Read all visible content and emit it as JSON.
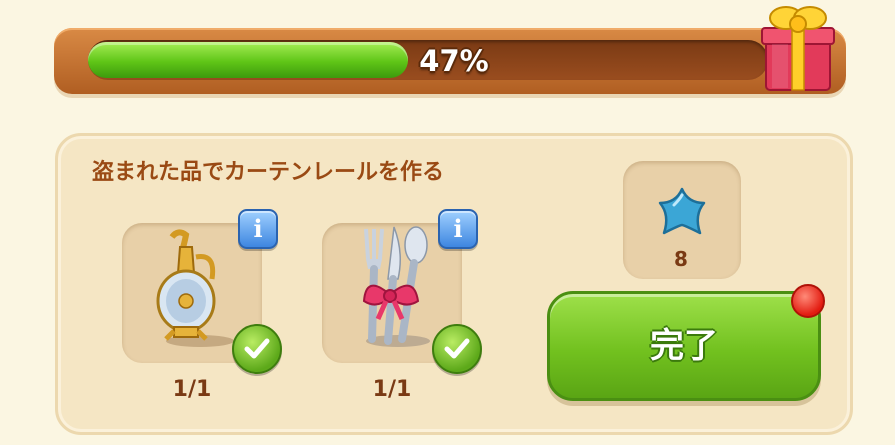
{
  "progress": {
    "percent_label": "47%",
    "fraction": 0.47
  },
  "quest": {
    "title": "盗まれた品でカーテンレールを作る",
    "items": [
      {
        "name": "golden-vase",
        "count": "1/1",
        "info_label": "i",
        "completed": true
      },
      {
        "name": "cutlery-with-bow",
        "count": "1/1",
        "info_label": "i",
        "completed": true
      }
    ]
  },
  "reward": {
    "icon": "blue-star-icon",
    "count": "8",
    "color": "#3ba6d6"
  },
  "complete_button": {
    "label": "完了",
    "has_notification": true
  },
  "colors": {
    "progress_green": "#5fc517",
    "frame_orange": "#c87634",
    "title_brown": "#9a4a14",
    "button_green": "#72c11f",
    "notification_red": "#e21b10"
  }
}
